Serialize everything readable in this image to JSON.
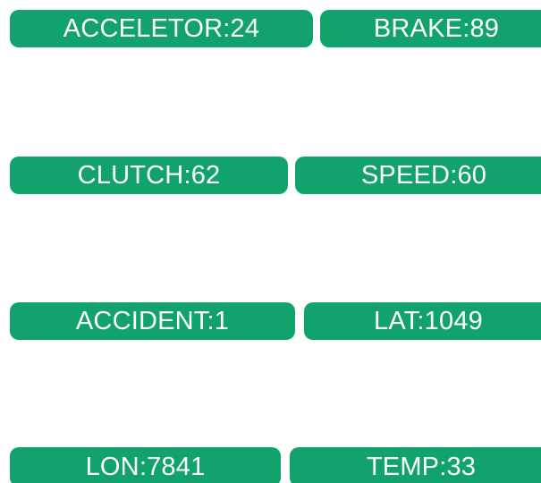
{
  "colors": {
    "button_bg": "#11a36b",
    "button_text": "#ffffff",
    "background": "#ffffff"
  },
  "buttons": [
    {
      "label": "ACCELETOR:24"
    },
    {
      "label": "BRAKE:89"
    },
    {
      "label": "CLUTCH:62"
    },
    {
      "label": "SPEED:60"
    },
    {
      "label": "ACCIDENT:1"
    },
    {
      "label": "LAT:1049"
    },
    {
      "label": "LON:7841"
    },
    {
      "label": "TEMP:33"
    }
  ]
}
